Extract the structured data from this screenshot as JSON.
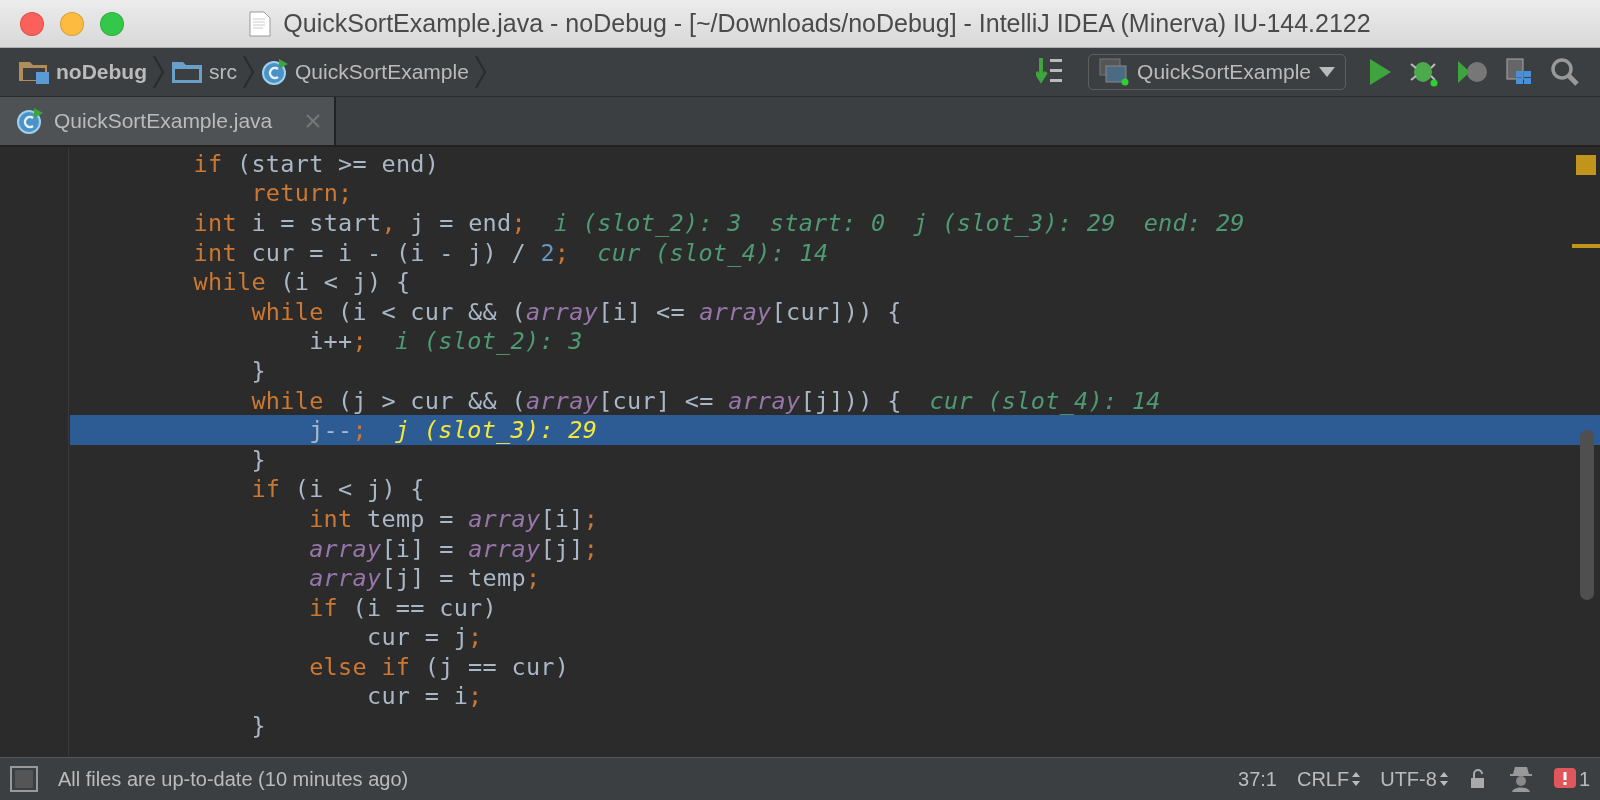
{
  "window": {
    "title": "QuickSortExample.java - noDebug - [~/Downloads/noDebug] - IntelliJ IDEA (Minerva) IU-144.2122"
  },
  "breadcrumbs": [
    {
      "label": "noDebug",
      "kind": "module"
    },
    {
      "label": "src",
      "kind": "folder"
    },
    {
      "label": "QuickSortExample",
      "kind": "class"
    }
  ],
  "toolbar": {
    "run_config": "QuickSortExample"
  },
  "tabs": [
    {
      "label": "QuickSortExample.java",
      "selected": true
    }
  ],
  "editor": {
    "lines": [
      {
        "selected": false,
        "tokens": [
          {
            "kind": "keyword",
            "text": "        if"
          },
          {
            "kind": "plain",
            "text": " (start >= end)"
          }
        ]
      },
      {
        "selected": false,
        "tokens": [
          {
            "kind": "keyword",
            "text": "            return;"
          }
        ]
      },
      {
        "selected": false,
        "tokens": [
          {
            "kind": "keyword",
            "text": "        int"
          },
          {
            "kind": "plain",
            "text": " i = start"
          },
          {
            "kind": "keyword",
            "text": ","
          },
          {
            "kind": "plain",
            "text": " j = end"
          },
          {
            "kind": "keyword",
            "text": ";"
          }
        ],
        "hints": [
          "i (slot_2): 3",
          "start: 0",
          "j (slot_3): 29",
          "end: 29"
        ]
      },
      {
        "selected": false,
        "tokens": [
          {
            "kind": "keyword",
            "text": "        int"
          },
          {
            "kind": "plain",
            "text": " cur = i - (i - j) / "
          },
          {
            "kind": "number",
            "text": "2"
          },
          {
            "kind": "keyword",
            "text": ";"
          }
        ],
        "hints": [
          "cur (slot_4): 14"
        ]
      },
      {
        "selected": false,
        "tokens": [
          {
            "kind": "keyword",
            "text": "        while"
          },
          {
            "kind": "plain",
            "text": " (i < j) {"
          }
        ]
      },
      {
        "selected": false,
        "tokens": [
          {
            "kind": "keyword",
            "text": "            while"
          },
          {
            "kind": "plain",
            "text": " (i < cur && ("
          },
          {
            "kind": "field",
            "text": "array"
          },
          {
            "kind": "plain",
            "text": "[i] <= "
          },
          {
            "kind": "field",
            "text": "array"
          },
          {
            "kind": "plain",
            "text": "[cur])) {"
          }
        ]
      },
      {
        "selected": false,
        "tokens": [
          {
            "kind": "plain",
            "text": "                i++"
          },
          {
            "kind": "keyword",
            "text": ";"
          }
        ],
        "hints": [
          "i (slot_2): 3"
        ]
      },
      {
        "selected": false,
        "tokens": [
          {
            "kind": "plain",
            "text": "            }"
          }
        ]
      },
      {
        "selected": false,
        "tokens": [
          {
            "kind": "keyword",
            "text": "            while"
          },
          {
            "kind": "plain",
            "text": " (j > cur && ("
          },
          {
            "kind": "field",
            "text": "array"
          },
          {
            "kind": "plain",
            "text": "[cur] <= "
          },
          {
            "kind": "field",
            "text": "array"
          },
          {
            "kind": "plain",
            "text": "[j])) {"
          }
        ],
        "hints": [
          "cur (slot_4): 14"
        ]
      },
      {
        "selected": true,
        "tokens": [
          {
            "kind": "plain",
            "text": "                j--"
          },
          {
            "kind": "keyword",
            "text": ";"
          }
        ],
        "hints": [
          "j (slot_3): 29"
        ]
      },
      {
        "selected": false,
        "tokens": [
          {
            "kind": "plain",
            "text": "            }"
          }
        ]
      },
      {
        "selected": false,
        "tokens": [
          {
            "kind": "keyword",
            "text": "            if"
          },
          {
            "kind": "plain",
            "text": " (i < j) {"
          }
        ]
      },
      {
        "selected": false,
        "tokens": [
          {
            "kind": "keyword",
            "text": "                int"
          },
          {
            "kind": "plain",
            "text": " temp = "
          },
          {
            "kind": "field",
            "text": "array"
          },
          {
            "kind": "plain",
            "text": "[i]"
          },
          {
            "kind": "keyword",
            "text": ";"
          }
        ]
      },
      {
        "selected": false,
        "tokens": [
          {
            "kind": "field",
            "text": "                array"
          },
          {
            "kind": "plain",
            "text": "[i] = "
          },
          {
            "kind": "field",
            "text": "array"
          },
          {
            "kind": "plain",
            "text": "[j]"
          },
          {
            "kind": "keyword",
            "text": ";"
          }
        ]
      },
      {
        "selected": false,
        "tokens": [
          {
            "kind": "field",
            "text": "                array"
          },
          {
            "kind": "plain",
            "text": "[j] = temp"
          },
          {
            "kind": "keyword",
            "text": ";"
          }
        ]
      },
      {
        "selected": false,
        "tokens": [
          {
            "kind": "keyword",
            "text": "                if"
          },
          {
            "kind": "plain",
            "text": " (i == cur)"
          }
        ]
      },
      {
        "selected": false,
        "tokens": [
          {
            "kind": "plain",
            "text": "                    cur = j"
          },
          {
            "kind": "keyword",
            "text": ";"
          }
        ]
      },
      {
        "selected": false,
        "tokens": [
          {
            "kind": "keyword",
            "text": "                else if"
          },
          {
            "kind": "plain",
            "text": " (j == cur)"
          }
        ]
      },
      {
        "selected": false,
        "tokens": [
          {
            "kind": "plain",
            "text": "                    cur = i"
          },
          {
            "kind": "keyword",
            "text": ";"
          }
        ]
      },
      {
        "selected": false,
        "tokens": [
          {
            "kind": "plain",
            "text": "            }"
          }
        ]
      }
    ]
  },
  "status_bar": {
    "message": "All files are up-to-date (10 minutes ago)",
    "position": "37:1",
    "line_separator": "CRLF",
    "encoding": "UTF-8",
    "error_count": "1"
  }
}
